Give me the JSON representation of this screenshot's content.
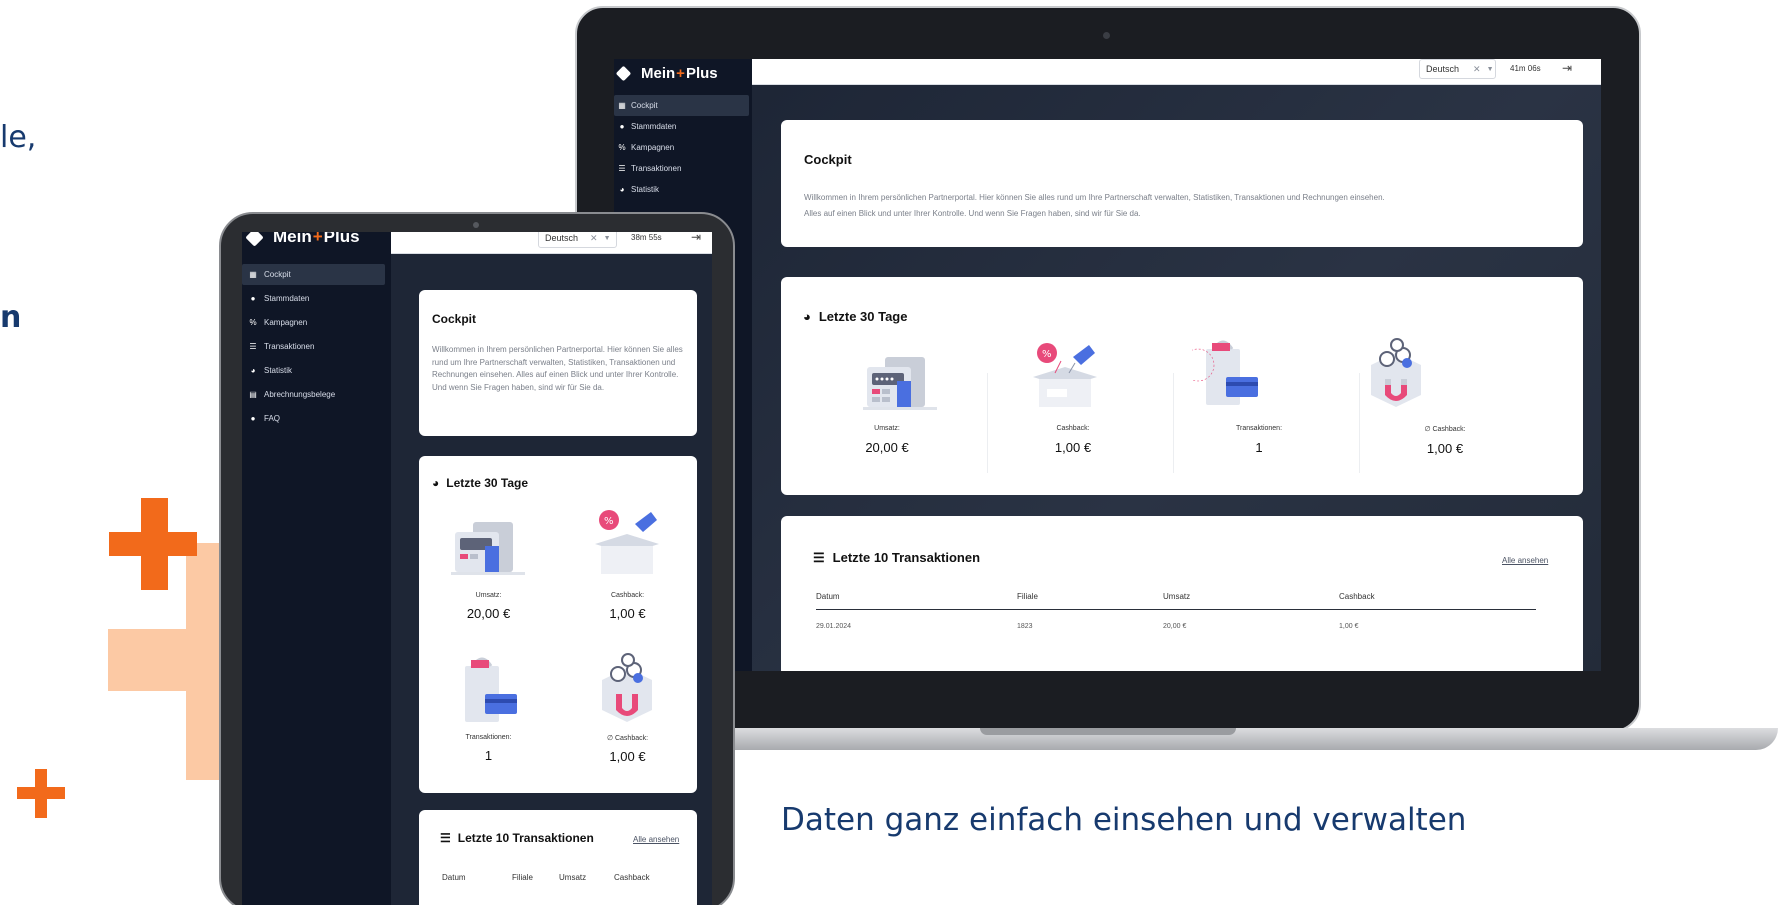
{
  "hero": {
    "fragment_1": "le,",
    "fragment_2": "n"
  },
  "colors": {
    "accent": "#f26a1b",
    "accent_light": "#fcc9a4",
    "accent_dark": "#6a3a22",
    "navy": "#173a6e",
    "sidebar": "#0f1626"
  },
  "app": {
    "brand_pre": "Mein",
    "brand_plus": "+",
    "brand_post": "Plus",
    "nav": [
      {
        "label": "Cockpit",
        "icon": "dashboard-icon"
      },
      {
        "label": "Stammdaten",
        "icon": "user-icon"
      },
      {
        "label": "Kampagnen",
        "icon": "percent-icon"
      },
      {
        "label": "Transaktionen",
        "icon": "list-icon"
      },
      {
        "label": "Statistik",
        "icon": "pie-chart-icon"
      },
      {
        "label": "Abrechnungsbelege",
        "icon": "document-icon"
      },
      {
        "label": "FAQ",
        "icon": "help-icon"
      }
    ],
    "language": "Deutsch",
    "laptop_timer": "41m 06s",
    "tablet_timer": "38m 55s",
    "cockpit_title": "Cockpit",
    "cockpit_text_laptop_1": "Willkommen in Ihrem persönlichen Partnerportal. Hier können Sie alles rund um Ihre Partnerschaft verwalten, Statistiken, Transaktionen und Rechnungen einsehen.",
    "cockpit_text_laptop_2": "Alles auf einen Blick und unter Ihrer Kontrolle. Und wenn Sie Fragen haben, sind wir für Sie da.",
    "cockpit_text_tablet": "Willkommen in Ihrem persönlichen Partnerportal. Hier können Sie alles rund um Ihre Partnerschaft verwalten, Statistiken, Transaktionen und Rechnungen einsehen. Alles auf einen Blick und unter Ihrer Kontrolle. Und wenn Sie Fragen haben, sind wir für Sie da.",
    "last30_title": "Letzte 30 Tage",
    "stats": [
      {
        "label": "Umsatz:",
        "value": "20,00 €"
      },
      {
        "label": "Cashback:",
        "value": "1,00 €"
      },
      {
        "label": "Transaktionen:",
        "value": "1"
      },
      {
        "label": "∅ Cashback:",
        "value": "1,00 €"
      }
    ],
    "last10_title": "Letzte 10 Transaktionen",
    "view_all": "Alle ansehen",
    "table_headers": [
      "Datum",
      "Filiale",
      "Umsatz",
      "Cashback"
    ],
    "table_rows": [
      [
        "29.01.2024",
        "1823",
        "20,00 €",
        "1,00 €"
      ]
    ]
  },
  "caption": "Daten ganz einfach einsehen und verwalten"
}
